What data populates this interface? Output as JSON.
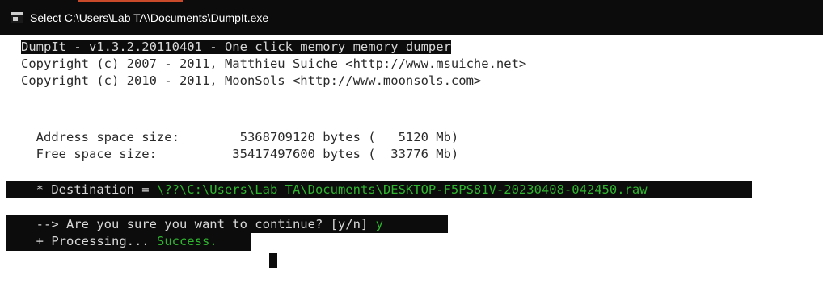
{
  "window": {
    "title": "Select C:\\Users\\Lab TA\\Documents\\DumpIt.exe"
  },
  "console": {
    "header": "DumpIt - v1.3.2.20110401 - One click memory memory dumper",
    "copyright1": "Copyright (c) 2007 - 2011, Matthieu Suiche <http://www.msuiche.net>",
    "copyright2": "Copyright (c) 2010 - 2011, MoonSols <http://www.moonsols.com>",
    "address_space": "  Address space size:        5368709120 bytes (   5120 Mb)",
    "free_space": "  Free space size:          35417497600 bytes (  33776 Mb)",
    "destination_label": "  * Destination = ",
    "destination_path": "\\??\\C:\\Users\\Lab TA\\Documents\\DESKTOP-F5PS81V-20230408-042450.raw",
    "confirm_prompt": "  --> Are you sure you want to continue? [y/n] ",
    "confirm_answer": "y",
    "processing_label": "  + Processing... ",
    "processing_status": "Success."
  },
  "colors": {
    "console_bg": "#ffffff",
    "highlight_bg": "#0c0c0c",
    "success_green": "#2fb52f"
  },
  "icons": {
    "window_icon": "console-window-icon",
    "cursor": "text-cursor-block"
  }
}
